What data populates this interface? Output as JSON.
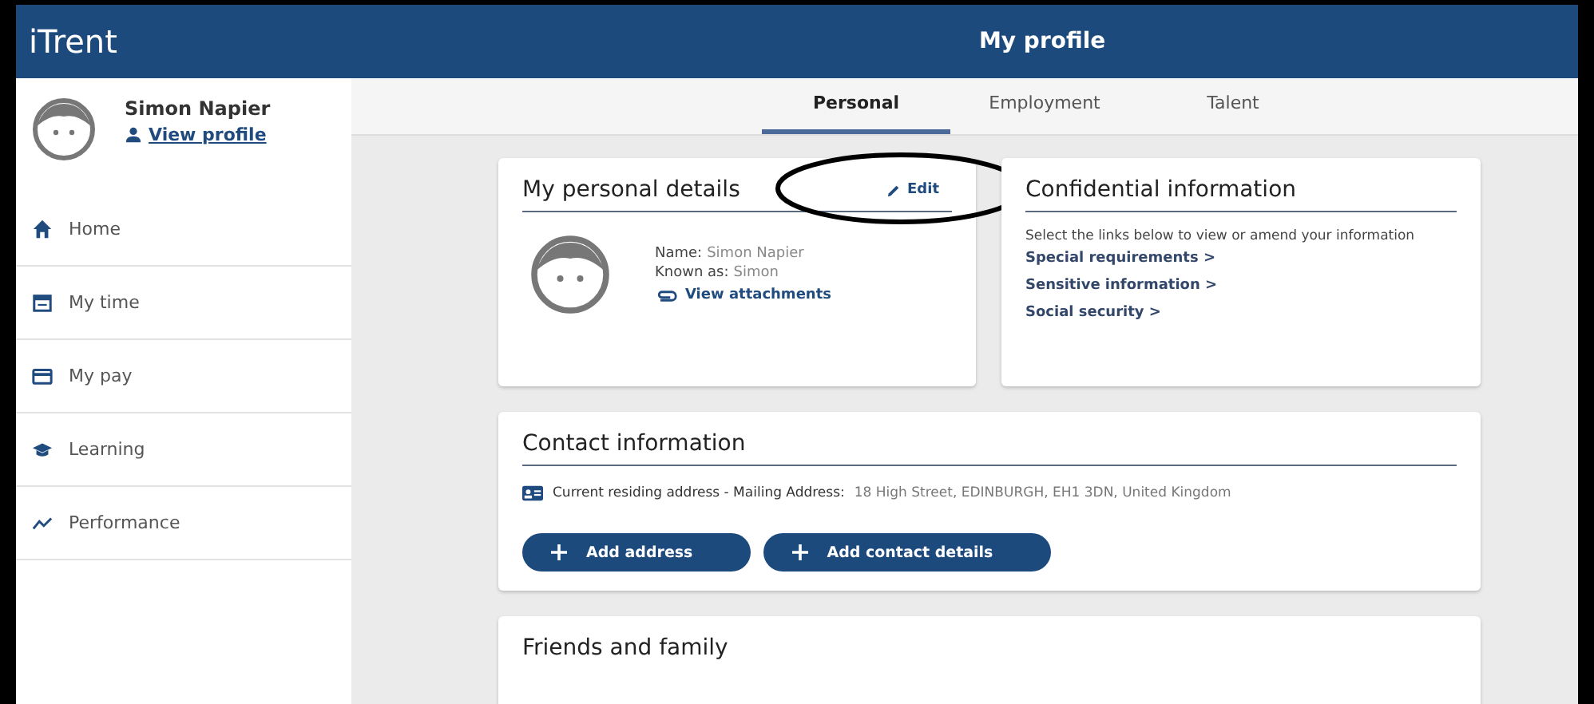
{
  "header": {
    "logo": "iTrent",
    "title": "My profile"
  },
  "user": {
    "name": "Simon Napier",
    "link": "View profile"
  },
  "nav": [
    {
      "label": "Home",
      "kind": "home"
    },
    {
      "label": "My time",
      "kind": "time"
    },
    {
      "label": "My pay",
      "kind": "pay"
    },
    {
      "label": "Learning",
      "kind": "learning"
    },
    {
      "label": "Performance",
      "kind": "performance"
    }
  ],
  "tabs": [
    {
      "label": "Personal",
      "selected": true
    },
    {
      "label": "Employment",
      "selected": false
    },
    {
      "label": "Talent",
      "selected": false
    }
  ],
  "personal": {
    "title": "My personal details",
    "edit": "Edit",
    "fields": [
      {
        "label": "Name:",
        "value": "Simon Napier"
      },
      {
        "label": "Known as:",
        "value": "Simon"
      }
    ],
    "attachments": "View attachments"
  },
  "confidential": {
    "title": "Confidential information",
    "intro": "Select the links below to view or amend your information",
    "links": [
      "Special requirements >",
      "Sensitive information >",
      "Social security >"
    ]
  },
  "contact": {
    "title": "Contact information",
    "address_label": "Current residing address - Mailing Address:",
    "address_value": "18 High Street, EDINBURGH, EH1 3DN, United Kingdom",
    "buttons": [
      "Add address",
      "Add contact details"
    ]
  },
  "friends": {
    "title": "Friends and family"
  }
}
